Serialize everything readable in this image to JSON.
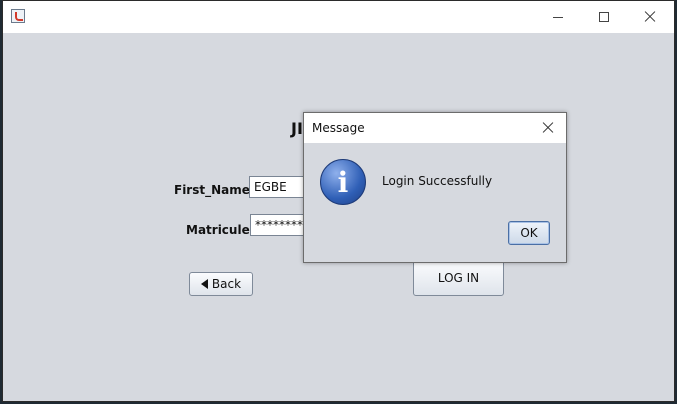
{
  "window": {
    "title": ""
  },
  "form": {
    "heading": "JI",
    "first_name_label": "First_Name",
    "first_name_value": "EGBE",
    "matricule_label": "Matricule",
    "matricule_value": "********",
    "back_label": "Back",
    "login_label": "LOG IN"
  },
  "dialog": {
    "title": "Message",
    "message": "Login Successfully",
    "ok_label": "OK",
    "icon": "info-icon"
  }
}
